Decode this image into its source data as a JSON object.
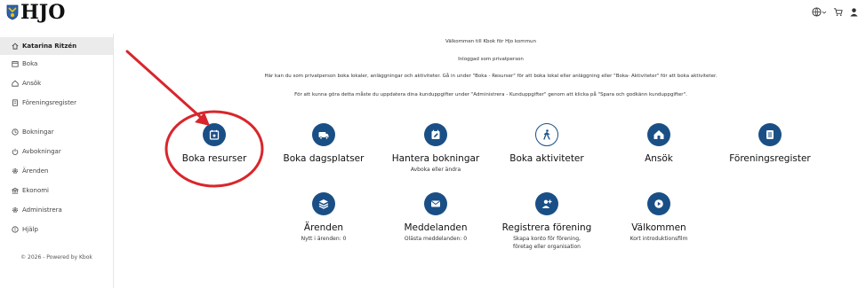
{
  "brand": {
    "name": "HJO"
  },
  "sidebar": {
    "items": [
      {
        "label": "Katarina Ritzén"
      },
      {
        "label": "Boka"
      },
      {
        "label": "Ansök"
      },
      {
        "label": "Föreningsregister"
      },
      {
        "label": "Bokningar"
      },
      {
        "label": "Avbokningar"
      },
      {
        "label": "Ärenden"
      },
      {
        "label": "Ekonomi"
      },
      {
        "label": "Administrera"
      },
      {
        "label": "Hjälp"
      }
    ],
    "footer": "© 2026 - Powered by Kbok"
  },
  "main": {
    "welcome_line1": "Välkommen till Kbok för Hjo kommun",
    "welcome_line2": "Inloggad som privatperson",
    "welcome_line3": "Här kan du som privatperson boka lokaler, anläggningar och aktiviteter. Gå in under \"Boka - Resurser\" för att boka lokal eller anläggning eller \"Boka- Aktiviteter\" för att boka aktiviteter.",
    "welcome_line4": "För att kunna göra detta måste du uppdatera dina kunduppgifter under \"Administrera - Kunduppgifter\" genom att klicka på \"Spara och godkänn kunduppgifter\".",
    "tiles": [
      {
        "label": "Boka resurser",
        "sub": "",
        "icon": "calendar-star-icon"
      },
      {
        "label": "Boka dagsplatser",
        "sub": "",
        "icon": "vehicle-icon"
      },
      {
        "label": "Hantera bokningar",
        "sub": "Avboka eller ändra",
        "icon": "calendar-edit-icon"
      },
      {
        "label": "Boka aktiviteter",
        "sub": "",
        "icon": "person-walking-icon"
      },
      {
        "label": "Ansök",
        "sub": "",
        "icon": "house-icon"
      },
      {
        "label": "Föreningsregister",
        "sub": "",
        "icon": "register-icon"
      },
      {
        "label": "Ärenden",
        "sub": "Nytt i ärenden: 0",
        "icon": "layers-icon"
      },
      {
        "label": "Meddelanden",
        "sub": "Olästa meddelanden: 0",
        "icon": "envelope-icon"
      },
      {
        "label": "Registrera förening",
        "sub": "Skapa konto för förening,",
        "sub2": "företag eller organisation",
        "icon": "add-user-icon"
      },
      {
        "label": "Välkommen",
        "sub": "Kort introduktionsfilm",
        "icon": "play-icon"
      }
    ]
  },
  "colors": {
    "accent": "#1a4f86",
    "annotation": "#d8262c",
    "sidebar_active": "#ebebeb"
  }
}
